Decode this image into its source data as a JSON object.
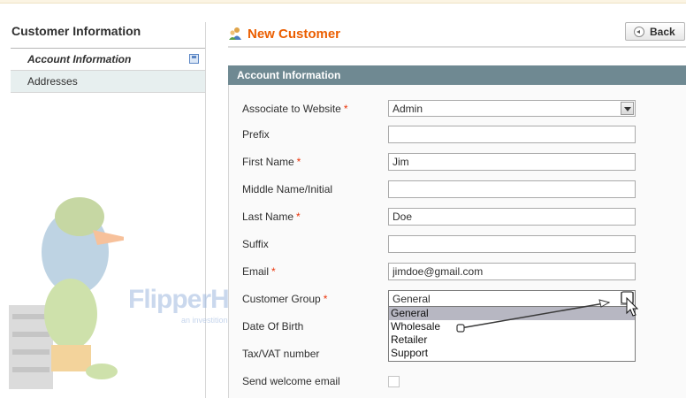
{
  "sidebar": {
    "title": "Customer Information",
    "items": [
      {
        "label": "Account Information",
        "active": true
      },
      {
        "label": "Addresses",
        "active": false
      }
    ]
  },
  "watermark": {
    "brand": "FlipperHost",
    "tagline": "an investition company"
  },
  "header": {
    "title": "New Customer",
    "back_label": "Back"
  },
  "section": {
    "title": "Account Information"
  },
  "form": {
    "associate_to_website": {
      "label": "Associate to Website",
      "required": "*",
      "value": "Admin"
    },
    "prefix": {
      "label": "Prefix",
      "value": ""
    },
    "first_name": {
      "label": "First Name",
      "required": "*",
      "value": "Jim"
    },
    "middle_name": {
      "label": "Middle Name/Initial",
      "value": ""
    },
    "last_name": {
      "label": "Last Name",
      "required": "*",
      "value": "Doe"
    },
    "suffix": {
      "label": "Suffix",
      "value": ""
    },
    "email": {
      "label": "Email",
      "required": "*",
      "value": "jimdoe@gmail.com"
    },
    "customer_group": {
      "label": "Customer Group",
      "required": "*",
      "value": "General",
      "options": [
        "General",
        "Wholesale",
        "Retailer",
        "Support"
      ],
      "highlighted": "General"
    },
    "date_of_birth": {
      "label": "Date Of Birth"
    },
    "tax_vat": {
      "label": "Tax/VAT number"
    },
    "send_welcome_email": {
      "label": "Send welcome email",
      "checked": false
    }
  },
  "colors": {
    "accent_title": "#eb5e00",
    "section_header": "#6f8992",
    "required": "#eb340a"
  }
}
